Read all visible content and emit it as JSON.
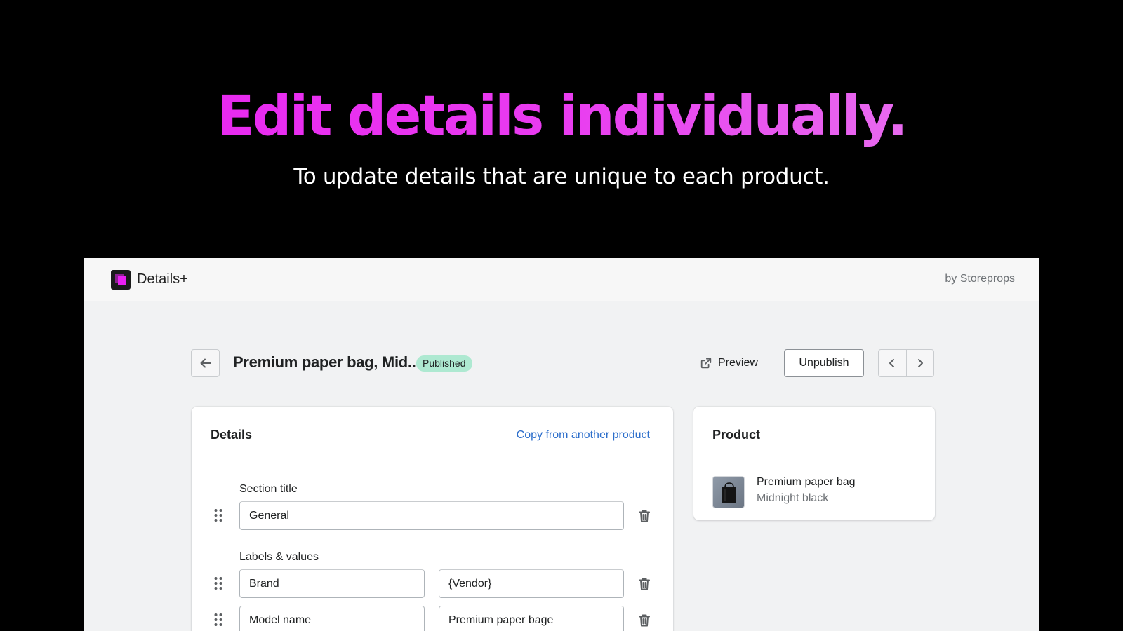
{
  "hero": {
    "title": "Edit details individually.",
    "subtitle": "To update details that are unique to each product."
  },
  "app": {
    "name": "Details+",
    "byline": "by Storeprops"
  },
  "page": {
    "title": "Premium paper bag, Mid..",
    "status": "Published",
    "preview_label": "Preview",
    "unpublish_label": "Unpublish"
  },
  "details_card": {
    "title": "Details",
    "copy_link": "Copy from another product",
    "section_title_label": "Section title",
    "section_title_value": "General",
    "labels_values_label": "Labels & values",
    "rows": [
      {
        "label": "Brand",
        "value": "{Vendor}"
      },
      {
        "label": "Model name",
        "value": "Premium paper bage"
      }
    ]
  },
  "product_card": {
    "title": "Product",
    "product_name": "Premium paper bag",
    "variant": "Midnight black"
  },
  "colors": {
    "accent_magenta": "#e81ff0",
    "link_blue": "#2c6ecb",
    "badge_green": "#aee9d1"
  },
  "icons": [
    "arrow-left-icon",
    "external-link-icon",
    "chevron-left-icon",
    "chevron-right-icon",
    "drag-handle-icon",
    "trash-icon"
  ]
}
